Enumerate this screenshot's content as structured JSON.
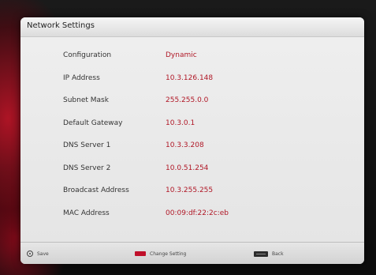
{
  "window": {
    "title": "Network Settings"
  },
  "settings": [
    {
      "label": "Configuration",
      "value": "Dynamic"
    },
    {
      "label": "IP Address",
      "value": "10.3.126.148"
    },
    {
      "label": "Subnet Mask",
      "value": "255.255.0.0"
    },
    {
      "label": "Default Gateway",
      "value": "10.3.0.1"
    },
    {
      "label": "DNS Server 1",
      "value": "10.3.3.208"
    },
    {
      "label": "DNS Server 2",
      "value": "10.0.51.254"
    },
    {
      "label": "Broadcast Address",
      "value": "10.3.255.255"
    },
    {
      "label": "MAC Address",
      "value": "00:09:df:22:2c:eb"
    }
  ],
  "footer": {
    "save_label": "Save",
    "change_label": "Change Setting",
    "back_label": "Back"
  },
  "icons": {
    "save": "ok-button-icon",
    "change": "red-button-icon",
    "back": "return-button-icon"
  },
  "colors": {
    "accent": "#b01726",
    "label": "#333333",
    "panel_bg": "#eaeaea"
  }
}
